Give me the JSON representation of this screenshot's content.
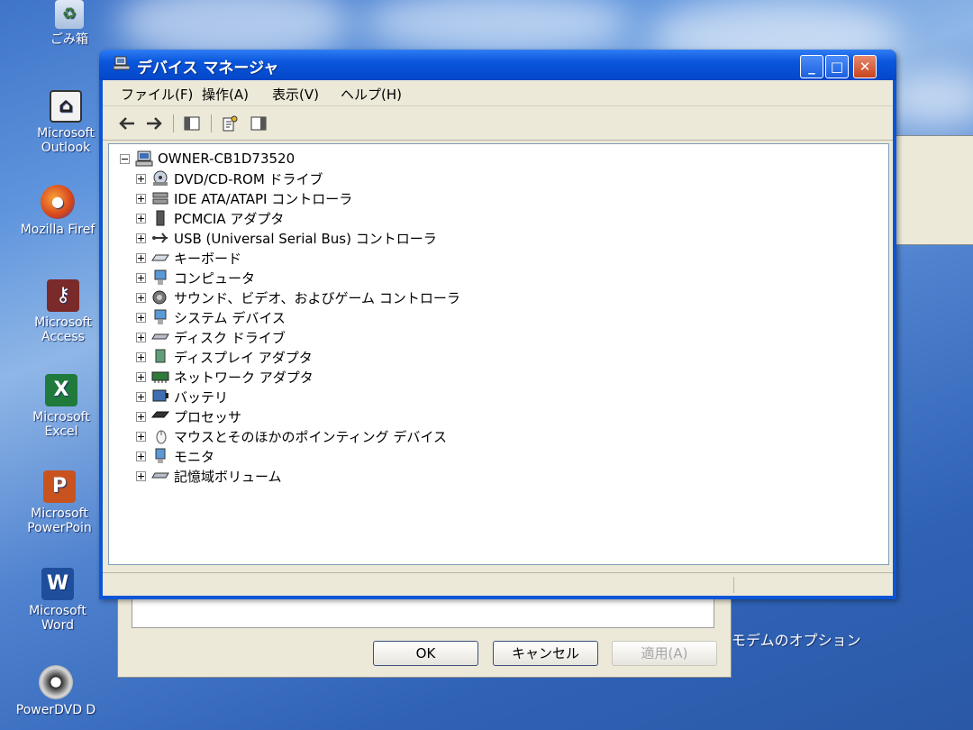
{
  "desktop": {
    "icons": [
      {
        "label": "ごみ箱"
      },
      {
        "label": "Microsoft Outlook"
      },
      {
        "label": "Mozilla Firef"
      },
      {
        "label": "Microsoft Access"
      },
      {
        "label": "Microsoft Excel"
      },
      {
        "label": "Microsoft PowerPoin"
      },
      {
        "label": "Microsoft Word"
      },
      {
        "label": "PowerDVD D"
      }
    ]
  },
  "background_dialog": {
    "ok_label": "OK",
    "cancel_label": "キャンセル",
    "apply_label": "適用(A)",
    "modem_options_label": "モデムのオプション"
  },
  "window": {
    "title": "デバイス マネージャ",
    "minimize_glyph": "_",
    "maximize_glyph": "□",
    "close_glyph": "✕"
  },
  "menubar": {
    "items": [
      {
        "label": "ファイル(F)"
      },
      {
        "label": "操作(A)"
      },
      {
        "label": "表示(V)"
      },
      {
        "label": "ヘルプ(H)"
      }
    ]
  },
  "tree": {
    "root": "OWNER-CB1D73520",
    "items": [
      {
        "label": "DVD/CD-ROM ドライブ",
        "icon": "dvd-drive-icon"
      },
      {
        "label": "IDE ATA/ATAPI コントローラ",
        "icon": "ide-controller-icon"
      },
      {
        "label": "PCMCIA アダプタ",
        "icon": "pcmcia-adapter-icon"
      },
      {
        "label": "USB (Universal Serial Bus) コントローラ",
        "icon": "usb-icon"
      },
      {
        "label": "キーボード",
        "icon": "keyboard-icon"
      },
      {
        "label": "コンピュータ",
        "icon": "computer-icon"
      },
      {
        "label": "サウンド、ビデオ、およびゲーム コントローラ",
        "icon": "sound-icon"
      },
      {
        "label": "システム デバイス",
        "icon": "system-device-icon"
      },
      {
        "label": "ディスク ドライブ",
        "icon": "disk-drive-icon"
      },
      {
        "label": "ディスプレイ アダプタ",
        "icon": "display-adapter-icon"
      },
      {
        "label": "ネットワーク アダプタ",
        "icon": "network-adapter-icon"
      },
      {
        "label": "バッテリ",
        "icon": "battery-icon"
      },
      {
        "label": "プロセッサ",
        "icon": "processor-icon"
      },
      {
        "label": "マウスとそのほかのポインティング デバイス",
        "icon": "mouse-icon"
      },
      {
        "label": "モニタ",
        "icon": "monitor-icon"
      },
      {
        "label": "記憶域ボリューム",
        "icon": "storage-volume-icon"
      }
    ]
  },
  "colors": {
    "titlebar": "#0a56dc",
    "window_face": "#ece9d8",
    "tree_bg": "#ffffff"
  }
}
